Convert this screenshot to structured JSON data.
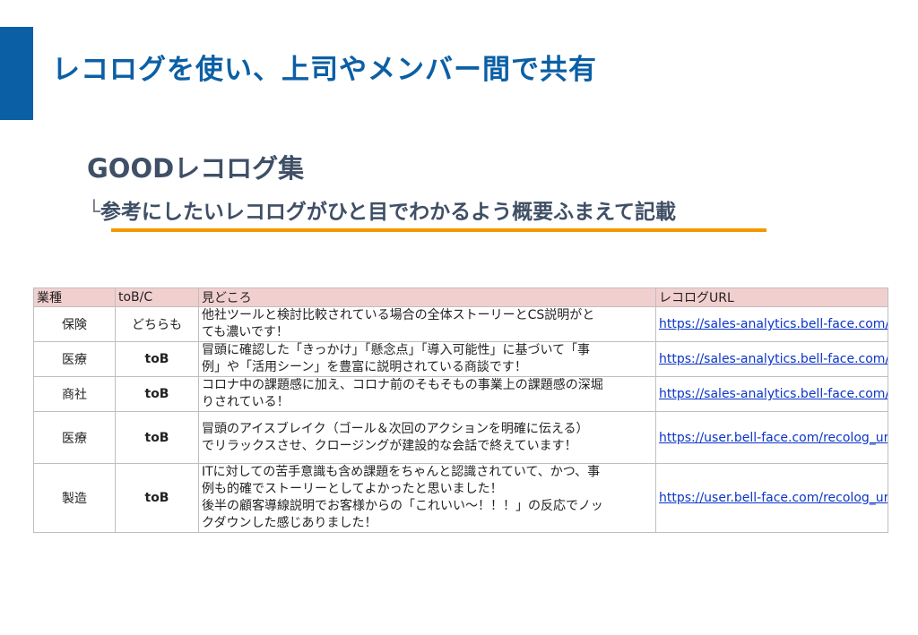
{
  "header": {
    "title": "レコログを使い、上司やメンバー間で共有",
    "accent_color": "#0b5fa5"
  },
  "section": {
    "title": "GOODレコログ集",
    "branch_mark": "└",
    "subtitle": "参考にしたいレコログがひと目でわかるよう概要ふまえて記載",
    "underline_color": "#f39800"
  },
  "table": {
    "headers": [
      "業種",
      "toB/C",
      "見どころ",
      "レコログURL"
    ],
    "header_bg": "#f2cfcf",
    "rows": [
      {
        "industry": "保険",
        "type": "どちらも",
        "note": "他社ツールと検討比較されている場合の全体ストーリーとCS説明がと\nても濃いです！",
        "url": "https://sales-analytics.bell-face.com/"
      },
      {
        "industry": "医療",
        "type": "toB",
        "note": "冒頭に確認した「きっかけ」「懸念点」「導入可能性」に基づいて「事\n例」や「活用シーン」を豊富に説明されている商談です！",
        "url": "https://sales-analytics.bell-face.com/"
      },
      {
        "industry": "商社",
        "type": "toB",
        "note": "コロナ中の課題感に加え、コロナ前のそもそもの事業上の課題感の深堀\nりされている！",
        "url": "https://sales-analytics.bell-face.com/"
      },
      {
        "industry": "医療",
        "type": "toB",
        "note": "冒頭のアイスブレイク（ゴール＆次回のアクションを明確に伝える）\nでリラックスさせ、クロージングが建設的な会話で終えています！",
        "url": "https://user.bell-face.com/recolog_ur"
      },
      {
        "industry": "製造",
        "type": "toB",
        "note": "ITに対しての苦手意識も含め課題をちゃんと認識されていて、かつ、事\n例も的確でストーリーとしてよかったと思いました！\n後半の顧客導線説明でお客様からの「これいい〜！！！」の反応でノッ\nクダウンした感じありました！",
        "url": "https://user.bell-face.com/recolog_ur"
      }
    ]
  }
}
